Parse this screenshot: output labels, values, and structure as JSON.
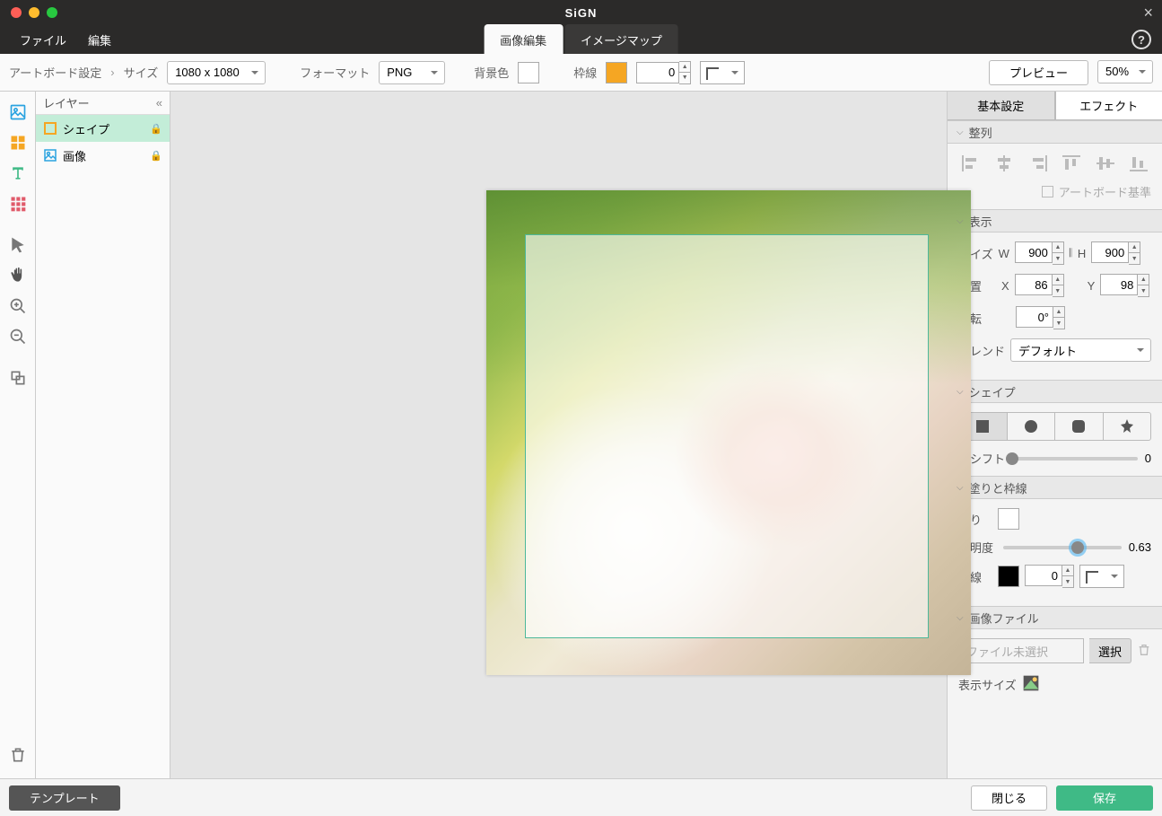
{
  "app_title": "SiGN",
  "menu": {
    "file": "ファイル",
    "edit": "編集"
  },
  "main_tabs": {
    "image_edit": "画像編集",
    "image_map": "イメージマップ"
  },
  "optbar": {
    "artboard": "アートボード設定",
    "size_lbl": "サイズ",
    "size_val": "1080 x 1080",
    "format_lbl": "フォーマット",
    "format_val": "PNG",
    "bg_lbl": "背景色",
    "bg_color": "#ffffff",
    "border_lbl": "枠線",
    "border_color": "#f5a623",
    "border_val": "0",
    "preview": "プレビュー",
    "zoom": "50%"
  },
  "layers": {
    "title": "レイヤー",
    "items": [
      {
        "name": "シェイプ",
        "type": "shape",
        "selected": true
      },
      {
        "name": "画像",
        "type": "image",
        "selected": false
      }
    ]
  },
  "props": {
    "tabs": {
      "basic": "基本設定",
      "effect": "エフェクト"
    },
    "align": {
      "title": "整列",
      "artboard_check": "アートボード基準"
    },
    "display": {
      "title": "表示",
      "size_lbl": "サイズ",
      "w_lbl": "W",
      "w": "900",
      "h_lbl": "H",
      "h": "900",
      "pos_lbl": "位置",
      "x_lbl": "X",
      "x": "86",
      "y_lbl": "Y",
      "y": "98",
      "rot_lbl": "回転",
      "rot": "0°",
      "blend_lbl": "ブレンド",
      "blend_val": "デフォルト"
    },
    "shape": {
      "title": "シェイプ",
      "shift_lbl": "枠シフト",
      "shift_val": "0"
    },
    "fill": {
      "title": "塗りと枠線",
      "fill_lbl": "塗り",
      "fill_color": "#ffffff",
      "opacity_lbl": "透明度",
      "opacity_val": "0.63",
      "border_lbl": "枠線",
      "border_color": "#000000",
      "border_val": "0"
    },
    "image_file": {
      "title": "画像ファイル",
      "placeholder": "ファイル未選択",
      "select_btn": "選択",
      "display_size_lbl": "表示サイズ"
    }
  },
  "footer": {
    "template": "テンプレート",
    "close": "閉じる",
    "save": "保存"
  }
}
